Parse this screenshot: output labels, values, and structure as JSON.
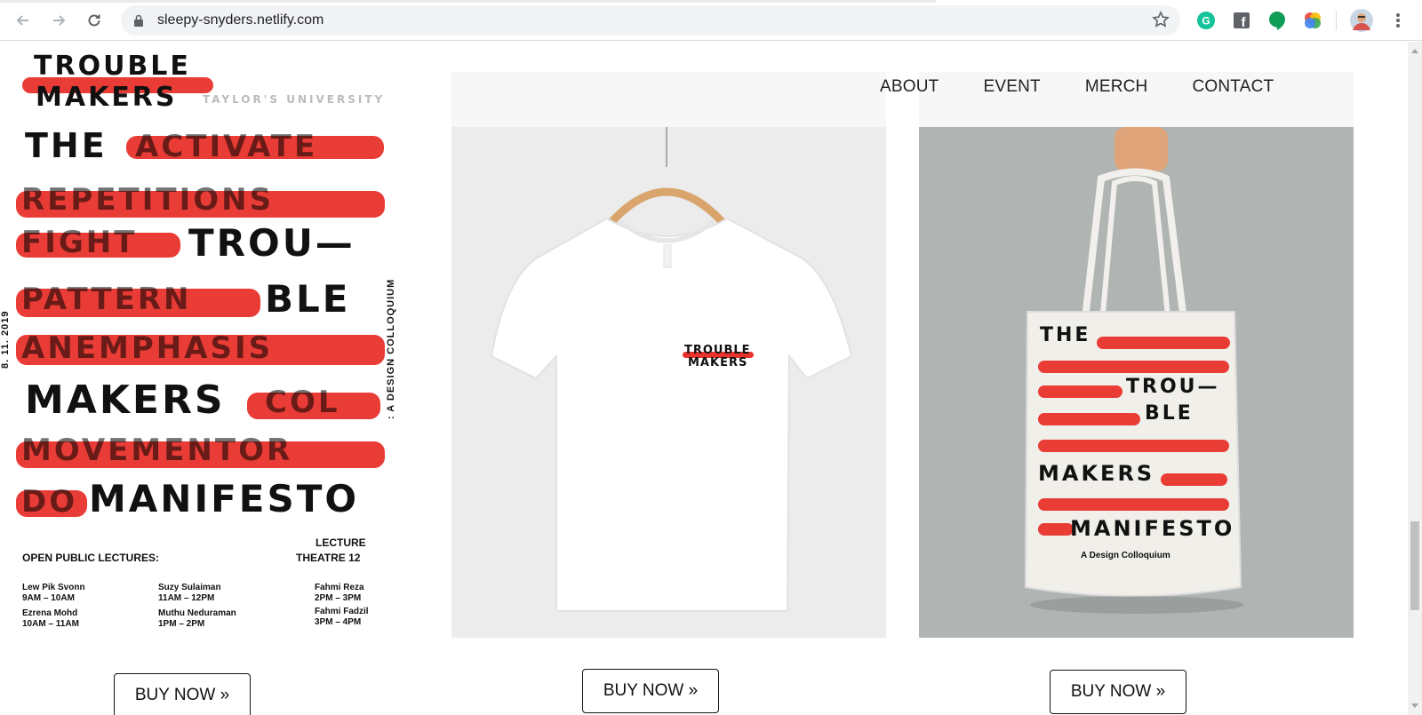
{
  "browser": {
    "url": "sleepy-snyders.netlify.com",
    "extensions": [
      "grammarly-icon",
      "facebook-icon",
      "hangouts-icon",
      "photos-icon"
    ]
  },
  "nav": {
    "items": [
      "ABOUT",
      "EVENT",
      "MERCH",
      "CONTACT"
    ]
  },
  "poster": {
    "title_top": "TROUBLE",
    "title_top2": "MAKERS",
    "university": "TAYLOR'S UNIVERSITY",
    "lines": [
      {
        "bold": "THE",
        "struck": "ACTIVATE"
      },
      {
        "bold": "",
        "struck": "REPETITIONS"
      },
      {
        "bold": "TROU—",
        "struck": "FIGHT"
      },
      {
        "bold": "BLE",
        "struck": "PATTERN"
      },
      {
        "bold": "",
        "struck": "ANEMPHASIS"
      },
      {
        "bold": "MAKERS",
        "struck": "COL"
      },
      {
        "bold": "",
        "struck": "MOVEMENTOR"
      },
      {
        "bold": "MANIFESTO",
        "struck": "DO"
      }
    ],
    "date_vertical": "8. 11. 2019",
    "colloquium_vertical": ": A DESIGN COLLOQUIUM",
    "venue_line1": "LECTURE",
    "venue_line2": "THEATRE 12",
    "lectures_heading": "OPEN PUBLIC LECTURES:",
    "speakers": [
      {
        "name": "Lew Pik Svonn",
        "time": "9AM – 10AM"
      },
      {
        "name": "Suzy Sulaiman",
        "time": "11AM – 12PM"
      },
      {
        "name": "Fahmi Reza",
        "time": "2PM – 3PM"
      },
      {
        "name": "Ezrena Mohd",
        "time": "10AM – 11AM"
      },
      {
        "name": "Muthu Neduraman",
        "time": "1PM – 2PM"
      },
      {
        "name": "Fahmi Fadzil",
        "time": "3PM – 4PM"
      }
    ]
  },
  "tshirt": {
    "logo_line1": "TROUBLE",
    "logo_line2": "MAKERS"
  },
  "tote": {
    "lines": [
      "THE",
      "TROU—",
      "BLE",
      "MAKERS",
      "MANIFESTO"
    ],
    "caption": "A Design Colloquium"
  },
  "buttons": {
    "buy_label": "BUY NOW »"
  },
  "colors": {
    "accent_red": "#e8322b",
    "tote_bg": "#b0b5b3"
  }
}
